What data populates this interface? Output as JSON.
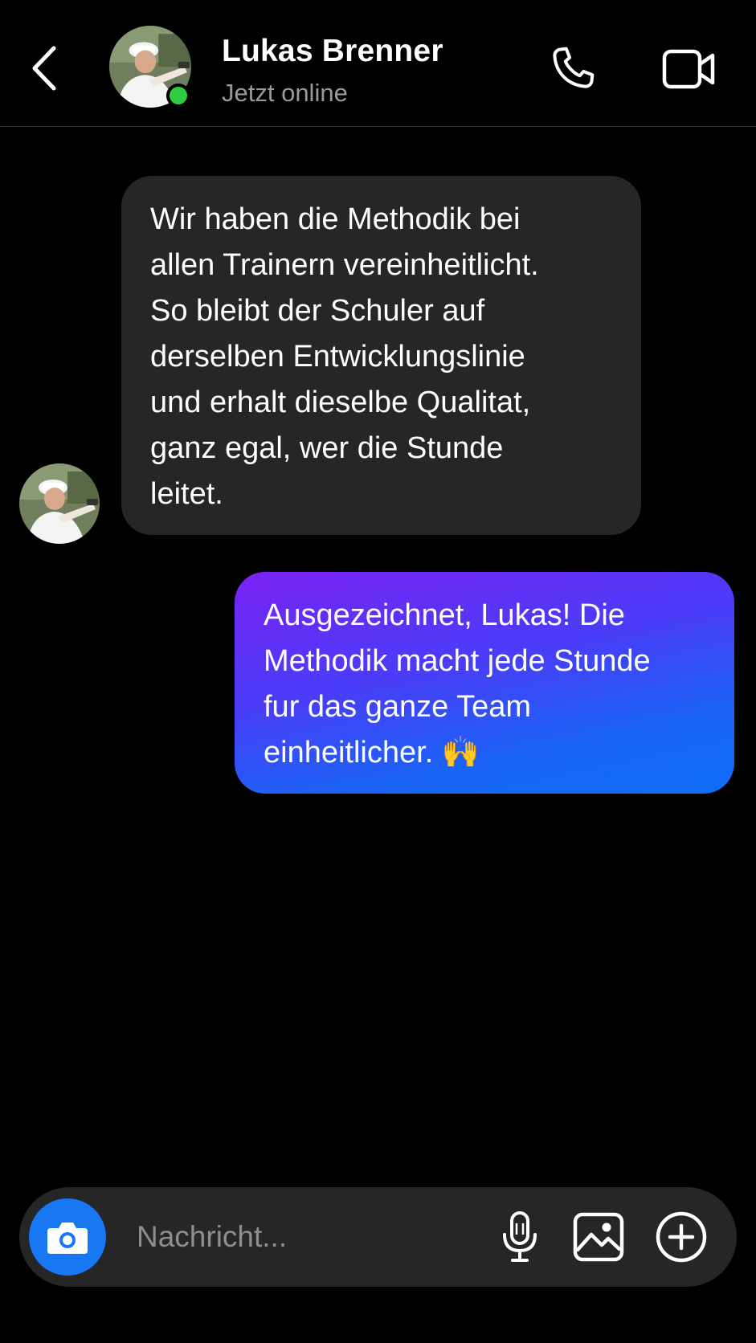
{
  "header": {
    "back_icon": "chevron-left-icon",
    "contact_name": "Lukas Brenner",
    "status": "Jetzt online",
    "status_color": "#2ecc40",
    "call_icon": "phone-icon",
    "video_icon": "video-camera-icon"
  },
  "messages": [
    {
      "direction": "incoming",
      "text": "Wir haben die Methodik bei\nallen Trainern vereinheitlicht.\nSo bleibt der Schuler auf\nderselben Entwicklungslinie\nund erhalt dieselbe Qualitat,\nganz egal, wer die Stunde\nleitet.",
      "bubble_color": "#262626"
    },
    {
      "direction": "outgoing",
      "text": "Ausgezeichnet, Lukas! Die\nMethodik macht jede Stunde\nfur das ganze Team\neinheitlicher. 🙌",
      "gradient": [
        "#7b22f5",
        "#0f6ef7"
      ]
    }
  ],
  "composer": {
    "placeholder": "Nachricht...",
    "camera_icon": "camera-icon",
    "mic_icon": "microphone-icon",
    "gallery_icon": "image-icon",
    "plus_icon": "plus-circle-icon",
    "accent": "#1877f2"
  }
}
